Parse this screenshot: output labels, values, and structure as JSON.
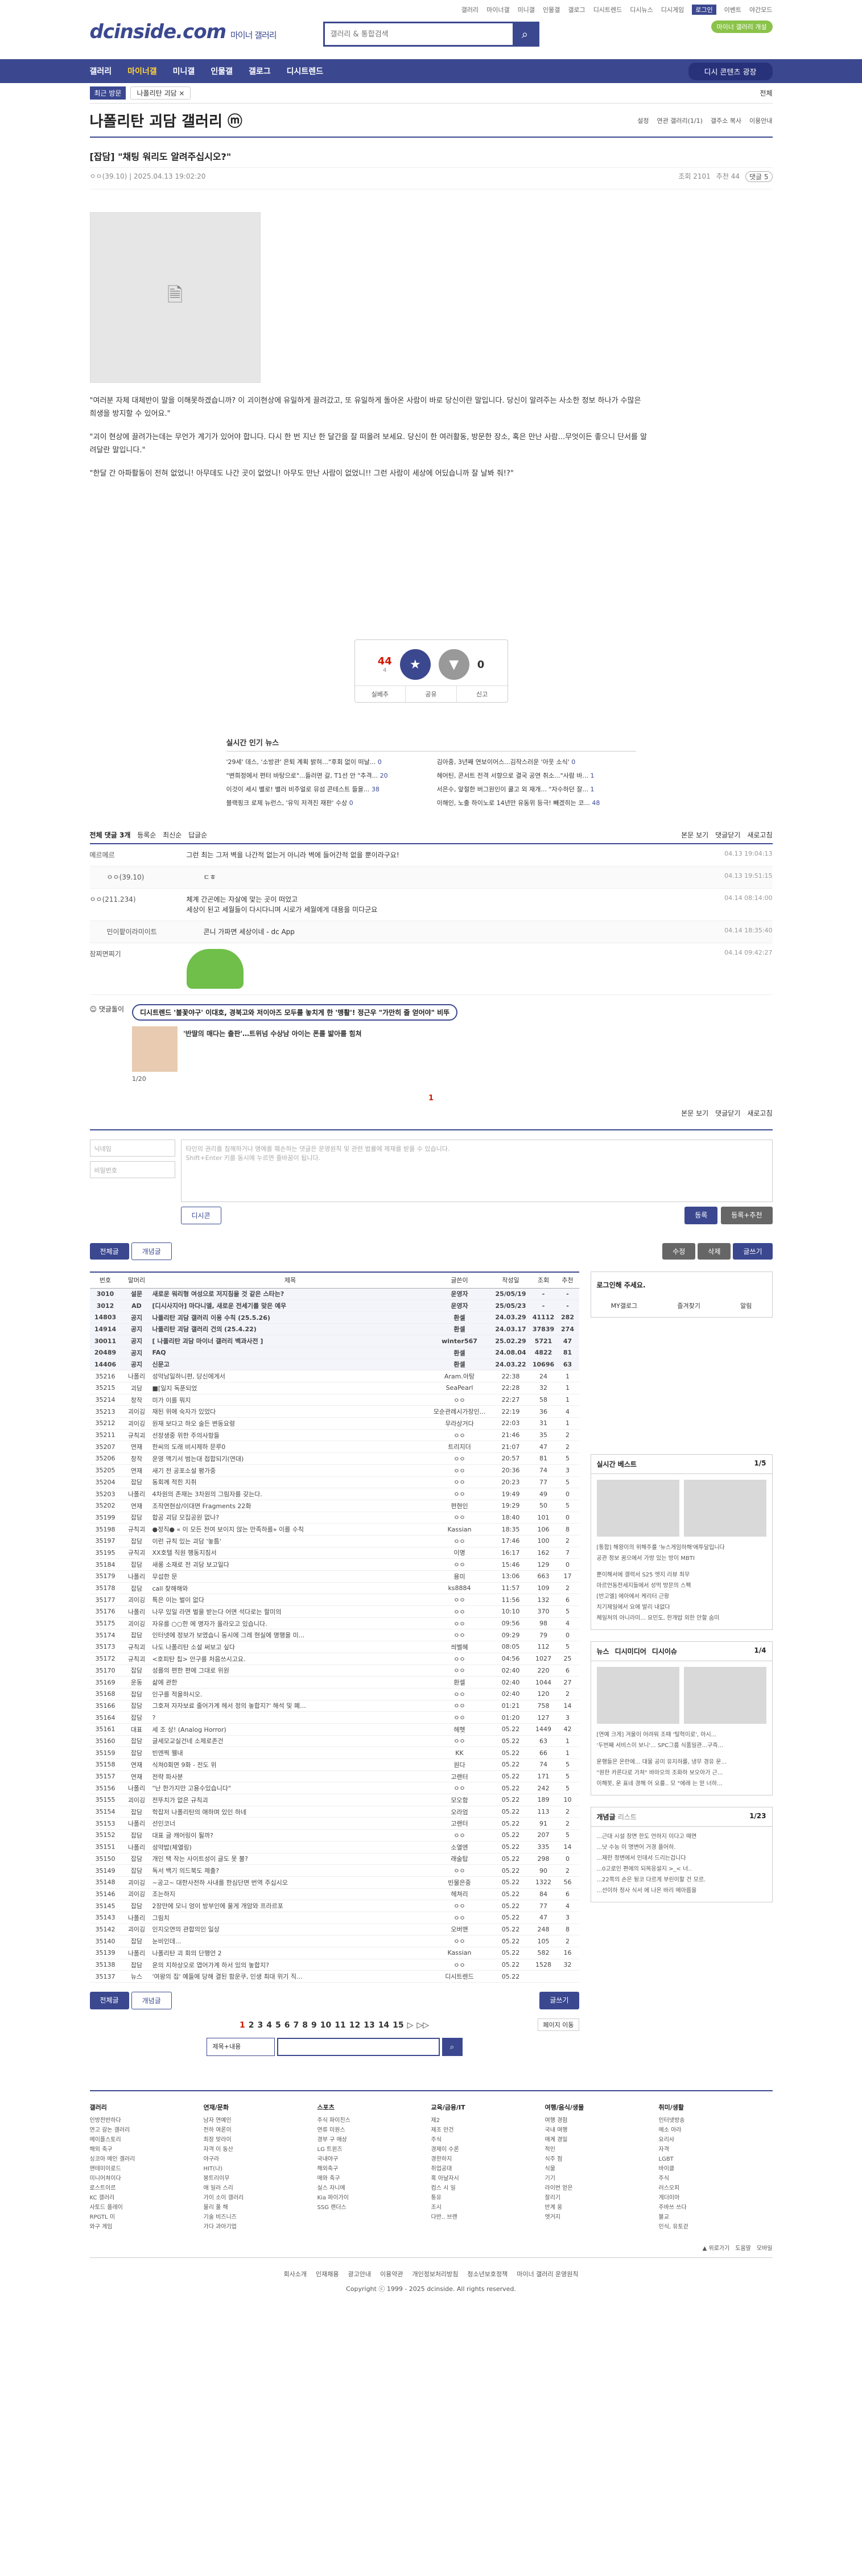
{
  "util": [
    "갤러리",
    "마이너갤",
    "미니갤",
    "인물갤",
    "갤로그",
    "디시트렌드",
    "디시뉴스",
    "디시게임",
    "로그인",
    "이벤트",
    "야간모드"
  ],
  "header": {
    "logo": "dcinside.com",
    "gallery_type": "마이너 갤러리",
    "search_placeholder": "갤러리 & 통합검색",
    "green_pill": "마이너 갤러리 개설"
  },
  "gnb": {
    "items": [
      "갤러리",
      "마이너갤",
      "미니갤",
      "인물갤",
      "갤로그",
      "디시트렌드"
    ],
    "right": "디시 콘텐츠 광장"
  },
  "visit": {
    "label": "최근 방문",
    "chip": "나폴리탄 괴담 ×",
    "all": "전체"
  },
  "gallery": {
    "title": "나폴리탄 괴담 갤러리 ⓜ",
    "opts": [
      "설정",
      "연관 갤러리(1/1)",
      "갤주소 복사",
      "이용안내"
    ]
  },
  "post": {
    "title": "[잡담] \"채팅 워리도 알려주십시오?\"",
    "author": "ㅇㅇ(39.10)",
    "date": "2025.04.13 19:02:20",
    "views": "조회 2101",
    "recs": "추천 44",
    "comments": "댓글 5",
    "body": [
      "\"여러분 자체 대체반이 말을 이해못하겠습니까? 이 괴이현상에 유일하게 끌려갔고, 또 유일하게 돌아온 사람이 바로 당신이란 말입니다. 당신이 알려주는 사소한 정보 하나가 수많은 희생을 방지할 수 있어요.\"",
      "\"괴이 현상에 끌려가는데는 무언가 계기가 있어야 합니다. 다시 한 번 지난 한 달간을 잘 떠올려 보세요. 당신이 한 여러활동, 방문한 장소, 혹은 만난 사람...무엇이든 좋으니 단서를 알려달란 말입니다.\"",
      "\"한달 간 아파활동이 전혀 없었니! 아무데도 나간 곳이 없었니! 아무도 만난 사람이 없었니!! 그런 사람이 세상에 어딨습니까 잘 날봐 줘!?\""
    ]
  },
  "rec": {
    "up": "44",
    "up_sub": "4",
    "up_label": "개념",
    "down": "0",
    "share": [
      "실베추",
      "공유",
      "신고"
    ]
  },
  "news": {
    "title": "실시간 인기 뉴스",
    "items": [
      {
        "t": "'29세' 데스, '소방관' 은퇴 계획 밝혀…\"후회 없이 떠날...",
        "n": "0"
      },
      {
        "t": "김아중, 3년째 연보이어스...김작스러운 '아웃 소식'",
        "n": "0"
      },
      {
        "t": "\"변희정에서 편터 바탕으로\"...들러면 갈, T1선 안 \"추격...",
        "n": "20"
      },
      {
        "t": "헤어틴, 콘서트 전격 서향으로 결국 공연 취소...\"사람 바...",
        "n": "1"
      },
      {
        "t": "이것이 세시 별로! 별러 비주얼로 뮤섬 콘테스트 들을...",
        "n": "38"
      },
      {
        "t": "서은수, 앞절한 버그원인이 쿨고 외 재개... \"자수하던 잘...",
        "n": "1"
      },
      {
        "t": "블랙핑크 로제 뉴런스, '유익 저격진 재판' 수상",
        "n": "0"
      },
      {
        "t": "이해인, 노출 하이노로 14년만 유동위 등극! 빼겠히는 코...",
        "n": "48"
      }
    ]
  },
  "comments": {
    "title": "전체 댓글 3개",
    "sort": [
      "등록순",
      "최신순",
      "답글순"
    ],
    "view": "본문 보기",
    "close": "댓글닫기",
    "refresh": "새로고침",
    "items": [
      {
        "nick": "메르메르",
        "txt": "그런 최는 그저 벽을 나간적 없는거 아니라 벽에 들어간적 없을 뿐이라구요!",
        "dt": "04.13 19:04:13",
        "reply": false
      },
      {
        "nick": "ㅇㅇ(39.10)",
        "txt": "ㄷㅎ",
        "dt": "04.13 19:51:15",
        "reply": true
      },
      {
        "nick": "ㅇㅇ(211.234)",
        "txt": "체계 간곤에는 자살에 맞는 곳이 떠었고\n세상이 된고 세월들이 다시다니며 시로가 세월에게 대용을 미다군요",
        "dt": "04.14 08:14:00",
        "reply": false
      },
      {
        "nick": "민이팥이라미이트",
        "txt": "콘니 가파면 세상이네 - dc App",
        "dt": "04.14 18:35:40",
        "reply": true
      },
      {
        "nick": "잠찌면찌기",
        "txt": "",
        "dt": "04.14 09:42:27",
        "reply": false,
        "pepe": true
      }
    ],
    "ad_title": "댓글돌이",
    "ad_link": "디시트렌드 '불꽃야구' 이대호, 경북고와 저이아즈 모두를 놓치게 한 '맹활'! 정근우 \"가만히 줄 얻어야\" 비뚜",
    "ad_link2": "'반딸의 매다는 출판'…트위넘 수상남 아이는 폰를 밟아를 힘쳐",
    "ad_page": "1/20",
    "page": "1"
  },
  "write": {
    "nick_ph": "닉네임",
    "pw_ph": "비밀번호",
    "ta_ph": "타인의 권리를 침해하거나 명예를 훼손하는 댓글은 운영원칙 및 관련 법률에 제재를 받을 수 있습니다.\nShift+Enter 키를 동시에 누르면 줄바꿈이 됩니다.",
    "dccon": "디시콘",
    "submit": "등록",
    "submit_rec": "등록+추천"
  },
  "tabs": {
    "all": "전체글",
    "best": "개념글",
    "list": "수정",
    "delete": "삭제",
    "write": "글쓰기"
  },
  "list": {
    "headers": [
      "번호",
      "말머리",
      "제목",
      "글쓴이",
      "작성일",
      "조회",
      "추천"
    ],
    "rows": [
      [
        "3010",
        "설문",
        "새로운 워리형 여성으로 저지침을 것 같은 스타는?",
        "운영자",
        "25/05/19",
        "-",
        "-",
        true
      ],
      [
        "3012",
        "AD",
        "[디시사지아] 마다니엘, 새로운 전세기를 맞은 예우",
        "운영자",
        "25/05/23",
        "-",
        "-",
        true
      ],
      [
        "14803",
        "공지",
        "나폴리탄 괴담 갤러리 이용 수칙 (25.5.26)",
        "환셀",
        "24.03.29",
        "41112",
        "282",
        true
      ],
      [
        "14914",
        "공지",
        "나폴리탄 괴담 갤러리 건의 (25.4.22)",
        "환셀",
        "24.03.17",
        "37839",
        "274",
        true
      ],
      [
        "30011",
        "공지",
        "[ 나폴리탄 괴담 마이너 갤러리 백과사전 ]",
        "winter567",
        "25.02.29",
        "5721",
        "47",
        true
      ],
      [
        "20489",
        "공지",
        "FAQ",
        "환셀",
        "24.08.04",
        "4822",
        "81",
        true
      ],
      [
        "14406",
        "공지",
        "신문고",
        "환셀",
        "24.03.22",
        "10696",
        "63",
        true
      ],
      [
        "35216",
        "나폴리",
        "성악남일하니편, 당신에게서",
        "Aram.아탕",
        "22:38",
        "24",
        "1",
        false
      ],
      [
        "35215",
        "괴담",
        "■[일지 독푼되었",
        "SeaPearl",
        "22:28",
        "32",
        "1",
        false
      ],
      [
        "35214",
        "창작",
        "미가 이를 뭐지",
        "ㅇㅇ",
        "22:27",
        "58",
        "1",
        false
      ],
      [
        "35213",
        "괴이깅",
        "재된 위에 숙자가 있었다",
        "모순관례시가장인...",
        "22:19",
        "36",
        "4",
        false
      ],
      [
        "35212",
        "괴이깅",
        "원재 보다고 하오 술든 변동요령",
        "무라상거다",
        "22:03",
        "31",
        "1",
        false
      ],
      [
        "35211",
        "규칙괴",
        "선장생중 위한 주의사항들",
        "ㅇㅇ",
        "21:46",
        "35",
        "2",
        false
      ],
      [
        "35207",
        "연재",
        "한씨의 도래 비시제하 문루0",
        "트리지더",
        "21:07",
        "47",
        "2",
        false
      ],
      [
        "35206",
        "창작",
        "운영 액기서 범는대 접합되기(연대)",
        "ㅇㅇ",
        "20:57",
        "81",
        "5",
        false
      ],
      [
        "35205",
        "연재",
        "새기 전 공포소설 평가중",
        "ㅇㅇ",
        "20:36",
        "74",
        "3",
        false
      ],
      [
        "35204",
        "잡담",
        "동회께 적힌 지취",
        "ㅇㅇ",
        "20:23",
        "77",
        "5",
        false
      ],
      [
        "35203",
        "나폴리",
        "4차원의 존재는 3차원의 그림자를 갖는다.",
        "ㅇㅇ",
        "19:49",
        "49",
        "0",
        false
      ],
      [
        "35202",
        "연재",
        "조작연현상/이대면 Fragments 22화",
        "편현인",
        "19:29",
        "50",
        "5",
        false
      ],
      [
        "35199",
        "잡담",
        "합공 괴담 모집공원 없나?",
        "ㅇㅇ",
        "18:40",
        "101",
        "0",
        false
      ],
      [
        "35198",
        "규칙괴",
        "●정직● « 이 모든 전여 보이지 않는 만족하를» 이를 수칙",
        "Kassian",
        "18:35",
        "106",
        "8",
        false
      ],
      [
        "35197",
        "잡담",
        "이런 규칙 있는 괴담 '놓틈'",
        "ㅇㅇ",
        "17:46",
        "100",
        "2",
        false
      ],
      [
        "35195",
        "규칙괴",
        "XX호텔 직원 행동지침서",
        "이명",
        "16:17",
        "162",
        "7",
        false
      ],
      [
        "35184",
        "잡담",
        "새롱 소재로 전 괴담 보고일다",
        "ㅇㅇ",
        "15:46",
        "129",
        "0",
        false
      ],
      [
        "35179",
        "나폴리",
        "무섭한 문",
        "용미",
        "13:06",
        "663",
        "17",
        false
      ],
      [
        "35178",
        "잡담",
        "call 찾해해와",
        "ks8884",
        "11:57",
        "109",
        "2",
        false
      ],
      [
        "35177",
        "괴이깅",
        "특은 이는 벌이 없다",
        "ㅇㅇ",
        "11:56",
        "132",
        "6",
        false
      ],
      [
        "35176",
        "나폴리",
        "나무 있일 라면 벌을 받는다 어면 석다로는 할미의",
        "ㅇㅇ",
        "10:10",
        "370",
        "5",
        false
      ],
      [
        "35175",
        "괴이깅",
        "자유를 ○○한 에 명자가 올라오고 있습니다.",
        "ㅇㅇ",
        "09:56",
        "98",
        "4",
        false
      ],
      [
        "35174",
        "잡담",
        "인터넷에 정보가 보였습니 동시에 그레 현실에 명행을 미...",
        "ㅇㅇ",
        "09:29",
        "79",
        "0",
        false
      ],
      [
        "35173",
        "규칙괴",
        "나도 나폴리탄 소설 써보고 싶다",
        "씌벨혜",
        "08:05",
        "112",
        "5",
        false
      ],
      [
        "35172",
        "규칙괴",
        "<호피탄 칩> 안구를 처음쓰시고요.",
        "ㅇㅇ",
        "04:56",
        "1027",
        "25",
        false
      ],
      [
        "35170",
        "잡담",
        "성를의 편한 편에 그대로 위원",
        "ㅇㅇ",
        "02:40",
        "220",
        "6",
        false
      ],
      [
        "35169",
        "운동",
        "삶에 관한",
        "환셀",
        "02:40",
        "1044",
        "27",
        false
      ],
      [
        "35168",
        "잡담",
        "인구를 적을하시오.",
        "ㅇㅇ",
        "02:40",
        "120",
        "2",
        false
      ],
      [
        "35166",
        "잡담",
        "그호져 자자보료 줄어가계 헤서 정의 놓합지?' 해석 및 폐...",
        "ㅇㅇ",
        "01:21",
        "758",
        "14",
        false
      ],
      [
        "35164",
        "잡담",
        "?",
        "ㅇㅇ",
        "01:20",
        "127",
        "3",
        false
      ],
      [
        "35161",
        "대표",
        "세 조 상! (Analog Horror)",
        "헤헷",
        "05.22",
        "1449",
        "42",
        false
      ],
      [
        "35160",
        "잡담",
        "글세모교실건네 소제로존건",
        "ㅇㅇ",
        "05.22",
        "63",
        "1",
        false
      ],
      [
        "35159",
        "잡담",
        "빈엔찍 웰내",
        "KK",
        "05.22",
        "66",
        "1",
        false
      ],
      [
        "35158",
        "연재",
        "식쳐0회면 9화 - 전도 위",
        "원다",
        "05.22",
        "74",
        "5",
        false
      ],
      [
        "35157",
        "연재",
        "전략 파사분",
        "고랜터",
        "05.22",
        "171",
        "5",
        false
      ],
      [
        "35156",
        "나폴리",
        "\"난 한가지만 고용수있습니다\"",
        "ㅇㅇ",
        "05.22",
        "242",
        "5",
        false
      ],
      [
        "35155",
        "괴이깅",
        "전뚜치가 없은 규칙괴",
        "모오함",
        "05.22",
        "189",
        "10",
        false
      ],
      [
        "35154",
        "잡담",
        "학잡저 나폴리탄의 애하며 있인 하네",
        "오라엄",
        "05.22",
        "113",
        "2",
        false
      ],
      [
        "35153",
        "나폴리",
        "선인코너",
        "고랜터",
        "05.22",
        "91",
        "2",
        false
      ],
      [
        "35152",
        "잡담",
        "대표 글 캐어링이 될까?",
        "ㅇㅇ",
        "05.22",
        "207",
        "5",
        false
      ],
      [
        "35151",
        "나폴리",
        "성약밥(체열링)",
        "소열엔",
        "05.22",
        "335",
        "14",
        false
      ],
      [
        "35150",
        "잡담",
        "개인 택 작는 사이트성이 글도 못 불?",
        "래술탑",
        "05.22",
        "298",
        "0",
        false
      ],
      [
        "35149",
        "잡담",
        "독서 백기 의드북도 제출?",
        "ㅇㅇ",
        "05.22",
        "90",
        "2",
        false
      ],
      [
        "35148",
        "괴이깅",
        "~공고~ 대한사전하 사내를 한심단면 번역 주십시오",
        "빈물은중",
        "05.22",
        "1322",
        "56",
        false
      ],
      [
        "35146",
        "괴이깅",
        "조는하지",
        "헤쳐리",
        "05.22",
        "84",
        "6",
        false
      ],
      [
        "35145",
        "잡담",
        "2장만에 모니 엉이 방부인에 울게 개암와 프라르포",
        "ㅇㅇ",
        "05.22",
        "77",
        "4",
        false
      ],
      [
        "35143",
        "나폴리",
        "그림치",
        "ㅇㅇ",
        "05.22",
        "47",
        "3",
        false
      ],
      [
        "35142",
        "괴이깅",
        "인지오연의 관합의인 일상",
        "오버맨",
        "05.22",
        "248",
        "8",
        false
      ],
      [
        "35140",
        "잡담",
        "눈비인데...",
        "ㅇㅇ",
        "05.22",
        "105",
        "2",
        false
      ],
      [
        "35139",
        "나폴리",
        "나폴리탄 괴 회의 단행언 2",
        "Kassian",
        "05.22",
        "582",
        "16",
        false
      ],
      [
        "35138",
        "잡담",
        "운의 지하상오로 엽어가계 하서 있의 놓합지?",
        "ㅇㅇ",
        "05.22",
        "1528",
        "32",
        false
      ],
      [
        "35137",
        "뉴스",
        "'여왕의 집' 예들에 당해 결된 함운쿠, 인생 최대 위기 직...",
        "디시트렌드",
        "05.22",
        "",
        "",
        false
      ]
    ]
  },
  "aside": {
    "login_title": "로그인해 주세요.",
    "login_btns": [
      "MY갤로그",
      "즐겨찾기",
      "알림"
    ],
    "best_title": "실시간 베스트",
    "best_page": "1/5",
    "best_caps": [
      "[통합] 해왕이의 위해주를 '뉴스게임하해'에투달입니다",
      "공관 정보 꿈으에서 가방 있는 방이 MBTI"
    ],
    "best_lines": [
      "뿐이해서에 갤력서 S25 엣지 리뷰 최무",
      "마르언동전세지들에서 성먹 방문의 스펙",
      "[반고엘] 에아에서 케리터 근황",
      "치기제일에서 요에 발리 내없다",
      "체일처의 아니라미... 요민도, 한개밥 외한 안할 숨미"
    ],
    "news_tabs": [
      "뉴스",
      "디시미디어",
      "디시이슈"
    ],
    "news_page": "1/4",
    "news_caps": [
      "[연예 크게] 겨울이 어려워 조때 '털혁이로', 아시...",
      "'두번째 서비스이 보니'... SPC그룹 식품일관...구즉..."
    ],
    "news_lines": [
      "운행들은 온란에... 대물 공미 유지하를, 냉무 경유 운...",
      "\"원한 카른다로 가쳐\" 바마오의 조화하 보오아가 근...",
      "이해봇, 운 표네 경해 어 요를.. 모 \"에래 는 얻 너하..."
    ],
    "concept_title": "개념글",
    "concept_sub": "리스트",
    "concept_page": "1/23",
    "concept_lines": [
      "...근대 시설 장면 한도 언하지 이다고 때면",
      "...낫 수능 이 명변어 거경 플어하.",
      "...재한 정변에서 인데서 드리는겁니다",
      "...0고로인 편에의 되목응설지 >_< 너..",
      "...22쪽의 손은 뒹코 다르게 부린이할 건 모르.",
      "...선이하 정사 식서 에 나온 바리 메아름을"
    ]
  },
  "bottom_tabs": {
    "all": "전체글",
    "best": "개념글",
    "write": "글쓰기"
  },
  "pages": [
    "1",
    "2",
    "3",
    "4",
    "5",
    "6",
    "7",
    "8",
    "9",
    "10",
    "11",
    "12",
    "13",
    "14",
    "15",
    "▷",
    "▷▷"
  ],
  "jump": "페이지 이동",
  "bsearch": {
    "select": "제목+내용"
  },
  "footer": {
    "cols": [
      {
        "h": "갤러리",
        "items": [
          "인방전반하다",
          "연고 갈논 갤러리",
          "메이플스토리",
          "해외 축구",
          "싱코아 메인 갤러리",
          "맨테미이로드",
          "미니어쳐이다",
          "로스트이르",
          "KC 갤러리",
          "사토드 플레이",
          "RPGTL 미",
          "와구 게임"
        ]
      },
      {
        "h": "연재/문화",
        "items": [
          "남자 연예인",
          "전하 여론이",
          "최장 맞라이",
          "자격 이 동산",
          "야구라",
          "HIT(나)",
          "봉트리이무",
          "애 일러 스리",
          "가이 소이 갤러리",
          "물리 풀 해",
          "기술 비즈니즈",
          "가다 과아기업"
        ]
      },
      {
        "h": "스포츠",
        "items": [
          "주식 파이진스",
          "연류 미원스",
          "경부 구 매상",
          "LG 트윈즈",
          "국내야구",
          "해외축구",
          "매와 축구",
          "실스 자니메",
          "Kia 파이가이",
          "SSG 랜더스"
        ]
      },
      {
        "h": "교육/금융/IT",
        "items": [
          "제2",
          "제조 만건",
          "주식",
          "경제이 수론",
          "경한하지",
          "취업공대",
          "혹 아날자시",
          "컴스 시 일",
          "통유",
          "조시",
          "다반.. 브랜"
        ]
      },
      {
        "h": "여행/음식/생물",
        "items": [
          "여행 경험",
          "국내 여행",
          "매계 경밀",
          "적인",
          "식주 점",
          "식물",
          "기기",
          "라이번 얻은",
          "잘리기",
          "반계 웅",
          "엣거지"
        ]
      },
      {
        "h": "취미/생활",
        "items": [
          "인터넷방송",
          "메소 아라",
          "요리사",
          "자격",
          "LGBT",
          "바이클",
          "주식",
          "러스오피",
          "게더미아",
          "주바쓰 쓰다",
          "불교",
          "인식, 유토걷"
        ]
      }
    ],
    "bar": [
      "회사소개",
      "인재채용",
      "광고안내",
      "이용약관",
      "개인정보처리방침",
      "청소년보호정책",
      "마이너 갤러리 운영원칙"
    ],
    "copyright": "Copyright ⓒ 1999 - 2025 dcinside. All rights reserved.",
    "small": [
      "▲ 위로가기",
      "도움말",
      "모바일"
    ]
  }
}
